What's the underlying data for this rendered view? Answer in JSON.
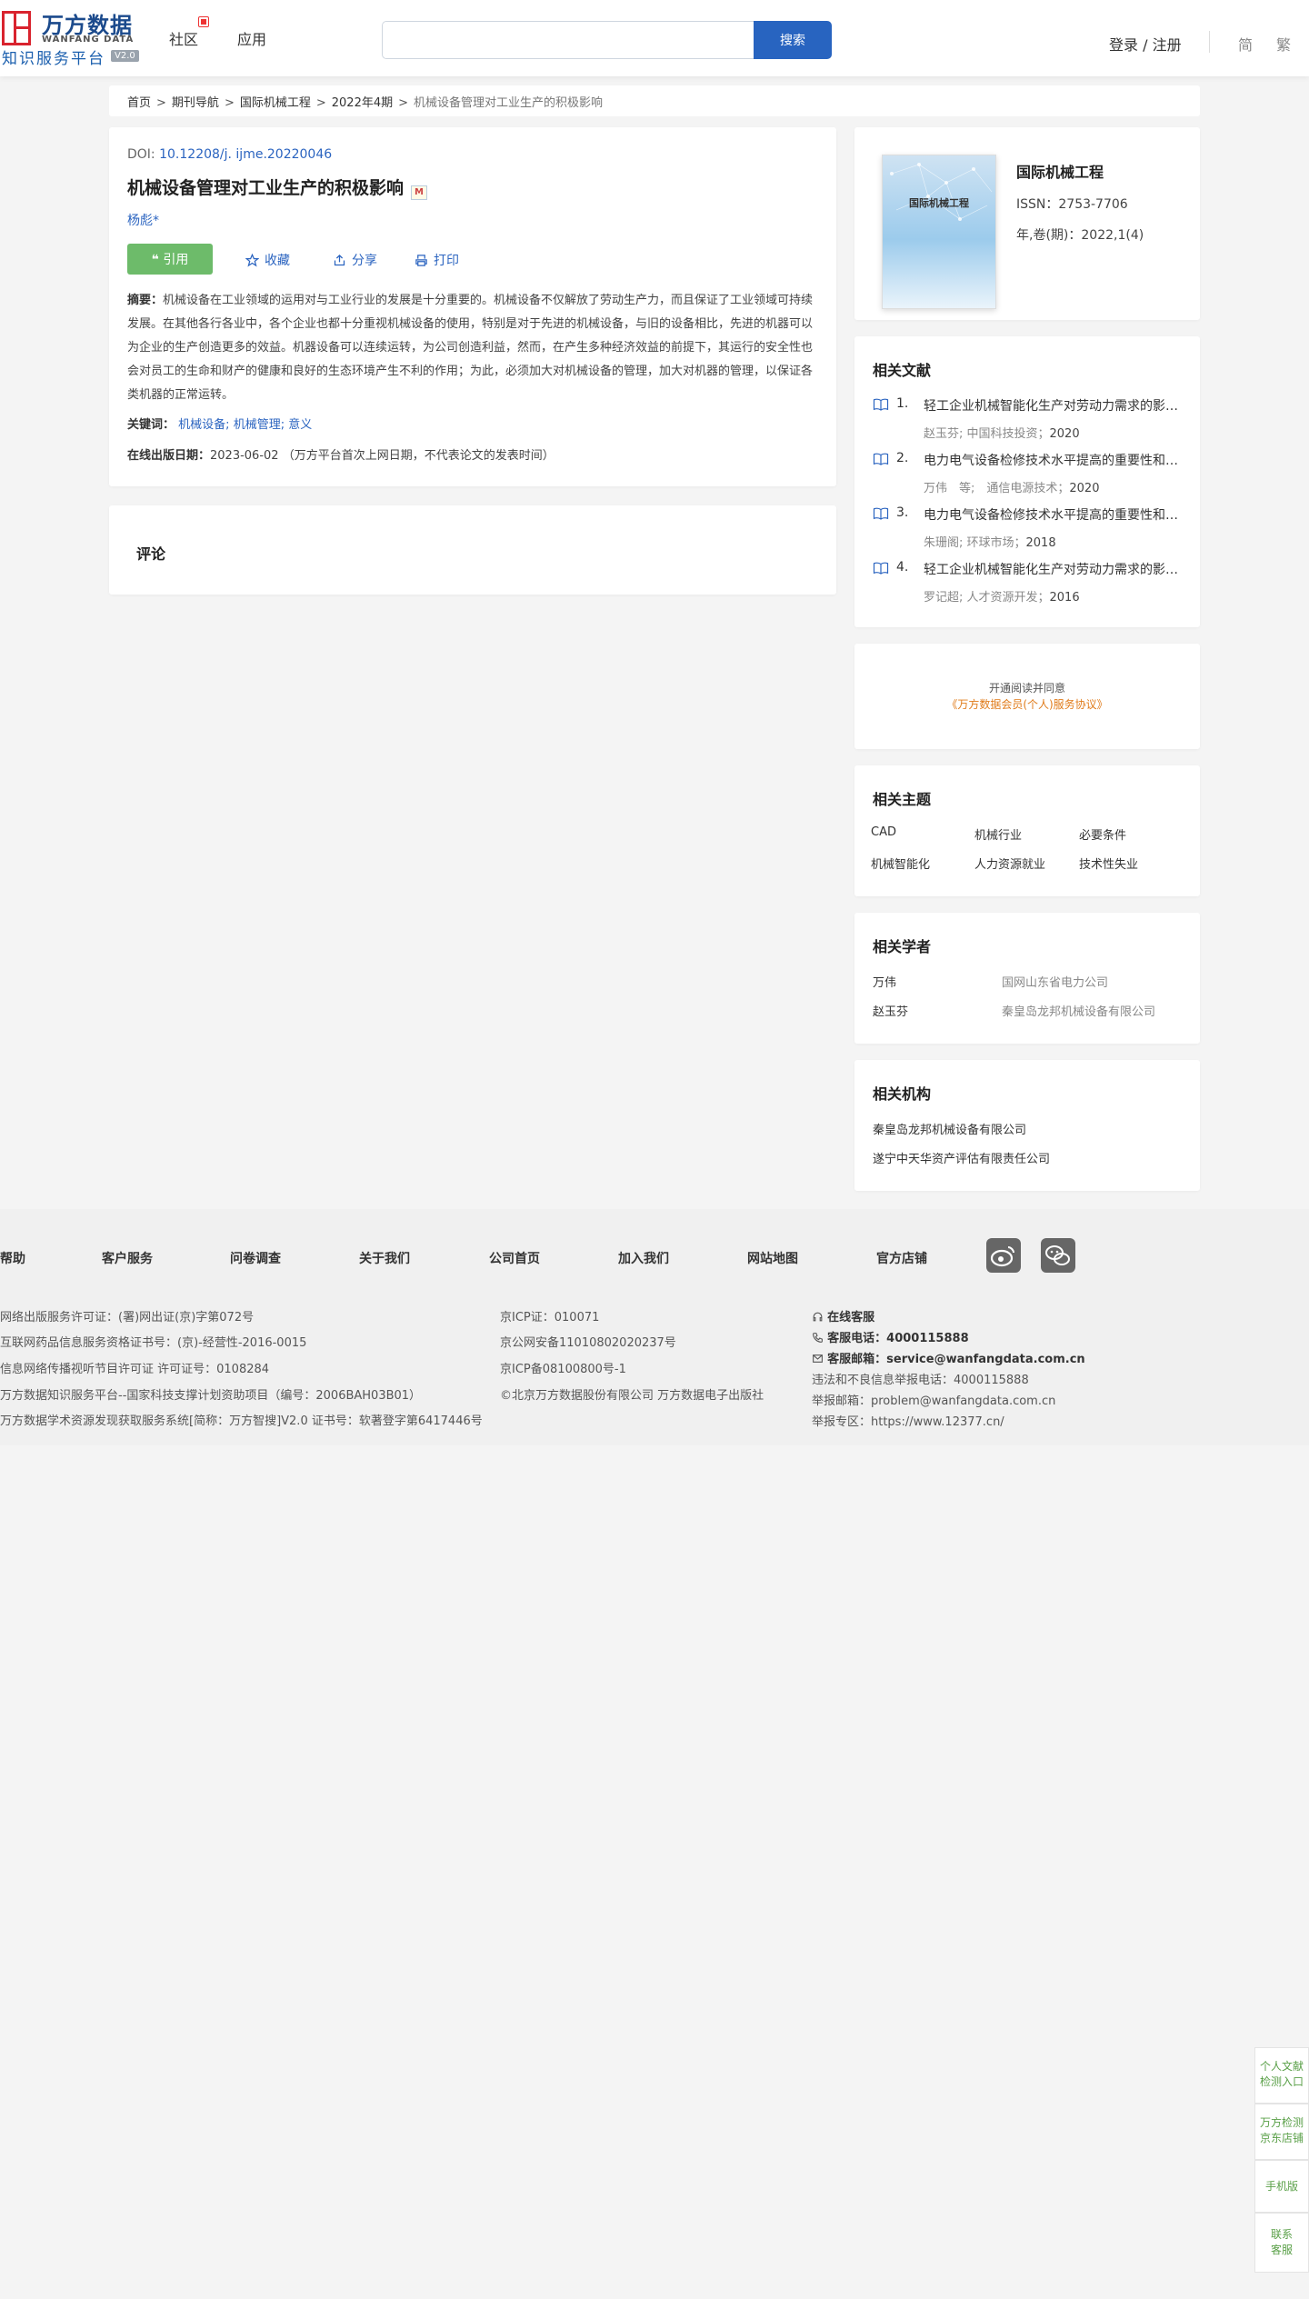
{
  "header": {
    "logo_cn": "万方数据",
    "logo_en": "WANFANG DATA",
    "logo_sub": "知识服务平台",
    "logo_version": "V2.0",
    "nav_community": "社区",
    "nav_apps": "应用",
    "search_value": "",
    "search_button": "搜索",
    "login": "登录 / 注册",
    "lang_simplified": "简",
    "lang_traditional": "繁"
  },
  "breadcrumb": {
    "home": "首页",
    "journal_nav": "期刊导航",
    "journal": "国际机械工程",
    "issue": "2022年4期",
    "current": "机械设备管理对工业生产的积极影响",
    "separator": ">"
  },
  "article": {
    "doi_label": "DOI:",
    "doi": "10.12208/j. ijme.20220046",
    "title": "机械设备管理对工业生产的积极影响",
    "m_badge": "M",
    "author": "杨彪*",
    "cite_button": "引用",
    "favorite": "收藏",
    "share": "分享",
    "print": "打印",
    "abstract_label": "摘要：",
    "abstract": "机械设备在工业领域的运用对与工业行业的发展是十分重要的。机械设备不仅解放了劳动生产力，而且保证了工业领域可持续发展。在其他各行各业中，各个企业也都十分重视机械设备的使用，特别是对于先进的机械设备，与旧的设备相比，先进的机器可以为企业的生产创造更多的效益。机器设备可以连续运转，为公司创造利益，然而，在产生多种经济效益的前提下，其运行的安全性也会对员工的生命和财产的健康和良好的生态环境产生不利的作用；为此，必须加大对机械设备的管理，加大对机器的管理，以保证各类机器的正常运转。",
    "keywords_label": "关键词：",
    "keywords": [
      "机械设备",
      "机械管理",
      "意义"
    ],
    "keyword_sep": ";",
    "pubdate_label": "在线出版日期：",
    "pubdate": "2023-06-02",
    "pubdate_note": "（万方平台首次上网日期，不代表论文的发表时间）"
  },
  "comments": {
    "title": "评论"
  },
  "journal_card": {
    "cover_title": "国际机械工程",
    "name": "国际机械工程",
    "issn": "ISSN：2753-7706",
    "volume": "年,卷(期)：2022,1(4)"
  },
  "related_docs": {
    "title": "相关文献",
    "items": [
      {
        "num": "1.",
        "title": "轻工企业机械智能化生产对劳动力需求的影响研究",
        "meta": "赵玉芬; 中国科技投资；",
        "year": "2020"
      },
      {
        "num": "2.",
        "title": "电力电气设备检修技术水平提高的重要性和措施",
        "meta": "万伟　等;　通信电源技术；",
        "year": "2020"
      },
      {
        "num": "3.",
        "title": "电力电气设备检修技术水平提高的重要性和措施",
        "meta": "朱珊阁; 环球市场；",
        "year": "2018"
      },
      {
        "num": "4.",
        "title": "轻工企业机械智能化生产对劳动力需求的影响研究",
        "meta": "罗记超; 人才资源开发；",
        "year": "2016"
      }
    ]
  },
  "agreement": {
    "line1": "开通阅读并同意",
    "line2": "《万方数据会员(个人)服务协议》"
  },
  "related_topics": {
    "title": "相关主题",
    "items": [
      "CAD",
      "机械行业",
      "必要条件",
      "机械智能化",
      "人力资源就业",
      "技术性失业"
    ]
  },
  "related_scholars": {
    "title": "相关学者",
    "items": [
      {
        "name": "万伟",
        "org": "国网山东省电力公司"
      },
      {
        "name": "赵玉芬",
        "org": "秦皇岛龙邦机械设备有限公司"
      }
    ]
  },
  "related_institutions": {
    "title": "相关机构",
    "items": [
      "秦皇岛龙邦机械设备有限公司",
      "遂宁中天华资产评估有限责任公司"
    ]
  },
  "footer": {
    "links": [
      "帮助",
      "客户服务",
      "问卷调查",
      "关于我们",
      "公司首页",
      "加入我们",
      "网站地图",
      "官方店铺"
    ],
    "col1": [
      "网络出版服务许可证：(署)网出证(京)字第072号",
      "互联网药品信息服务资格证书号：(京)-经营性-2016-0015",
      "信息网络传播视听节目许可证 许可证号：0108284",
      "万方数据知识服务平台--国家科技支撑计划资助项目（编号：2006BAH03B01）",
      "万方数据学术资源发现获取服务系统[简称：万方智搜]V2.0 证书号：软著登字第6417446号"
    ],
    "col2": [
      "京ICP证：010071",
      "京公网安备11010802020237号",
      "京ICP备08100800号-1",
      "©北京万方数据股份有限公司 万方数据电子出版社"
    ],
    "online_service": "在线客服",
    "phone_label": "客服电话：",
    "phone": "4000115888",
    "email_label": "客服邮箱：",
    "email": "service@wanfangdata.com.cn",
    "report_phone": "违法和不良信息举报电话：4000115888",
    "report_email": "举报邮箱：problem@wanfangdata.com.cn",
    "report_site": "举报专区：https://www.12377.cn/"
  },
  "float_tools": {
    "detect_entry_l1": "个人文献",
    "detect_entry_l2": "检测入口",
    "jd_store_l1": "万方检测",
    "jd_store_l2": "京东店铺",
    "mobile": "手机版",
    "contact_l1": "联系",
    "contact_l2": "客服"
  }
}
